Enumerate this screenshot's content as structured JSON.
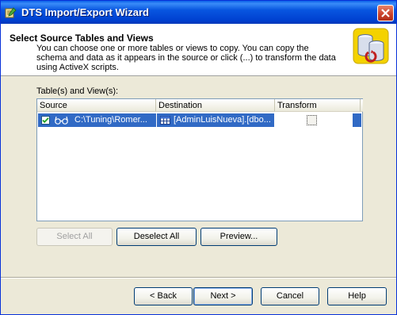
{
  "window": {
    "title": "DTS Import/Export Wizard",
    "title_icon": "wizard-app-icon",
    "close_icon": "close-x-icon"
  },
  "header": {
    "title": "Select Source Tables and Views",
    "description": "You can choose one or more tables or views to copy.  You can copy the schema and data as it appears in the source or click (...) to transform the data using ActiveX scripts.",
    "icon": "database-cylinders-icon"
  },
  "list": {
    "label": "Table(s) and View(s):",
    "columns": [
      "Source",
      "Destination",
      "Transform"
    ],
    "rows": [
      {
        "checked": true,
        "source_icon": "view-glasses-icon",
        "source": "C:\\Tuning\\Romer...",
        "destination_icon": "table-grid-icon",
        "destination": "[AdminLuisNueva].[dbo...",
        "transform_button": "ellipsis-button"
      }
    ]
  },
  "buttons": {
    "select_all": "Select All",
    "deselect_all": "Deselect All",
    "preview": "Preview...",
    "back": "< Back",
    "next": "Next >",
    "cancel": "Cancel",
    "help": "Help"
  },
  "colors": {
    "titlebar": "#0054e3",
    "selection": "#316ac5",
    "dialog_bg": "#ece9d8"
  }
}
